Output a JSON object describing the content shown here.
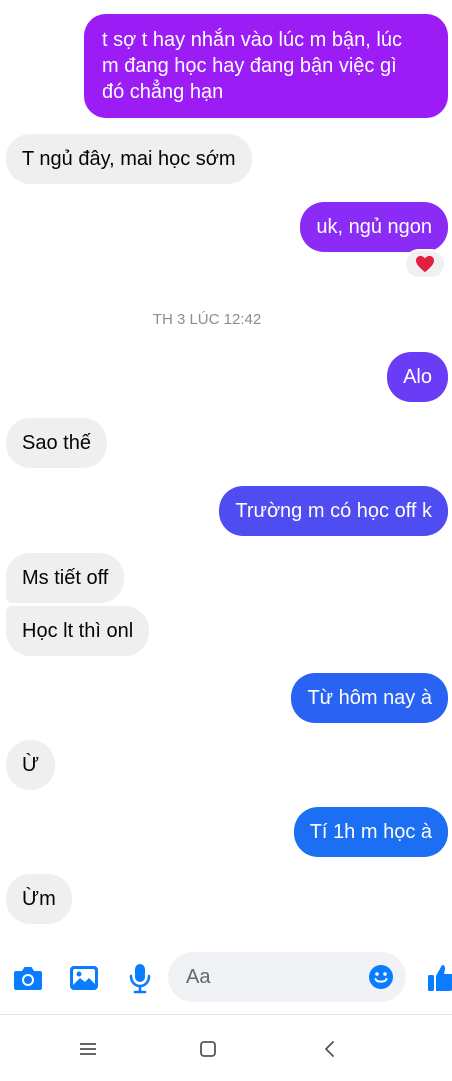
{
  "messages": [
    {
      "id": "m1",
      "direction": "out",
      "text": "t sợ t hay nhắn vào lúc m bận, lúc\nm đang học hay đang bận việc gì\nđó chẳng hạn"
    },
    {
      "id": "m2",
      "direction": "in",
      "text": "T ngủ đây, mai học sớm"
    },
    {
      "id": "m3",
      "direction": "out",
      "text": "uk, ngủ ngon"
    },
    {
      "id": "m4",
      "direction": "out",
      "text": "Alo"
    },
    {
      "id": "m5",
      "direction": "in",
      "text": "Sao thế"
    },
    {
      "id": "m6",
      "direction": "out",
      "text": "Trường m có học off k"
    },
    {
      "id": "m7",
      "direction": "in",
      "text": "Ms tiết off"
    },
    {
      "id": "m8",
      "direction": "in",
      "text": "Học lt thì onl"
    },
    {
      "id": "m9",
      "direction": "out",
      "text": "Từ hôm nay à"
    },
    {
      "id": "m10",
      "direction": "in",
      "text": "Ừ"
    },
    {
      "id": "m11",
      "direction": "out",
      "text": "Tí 1h m học à"
    },
    {
      "id": "m12",
      "direction": "in",
      "text": "Ừm"
    }
  ],
  "timestamp": "TH 3 LÚC 12:42",
  "reaction": {
    "emoji": "heart",
    "color": "#e41e3f"
  },
  "composer": {
    "placeholder": "Aa",
    "icons": [
      "camera-icon",
      "image-icon",
      "microphone-icon",
      "emoji-icon",
      "like-icon"
    ]
  },
  "colors": {
    "accent": "#0a7cff",
    "purple": "#9b1cf5",
    "violet": "#6a3cf5",
    "incoming": "#efefef"
  },
  "navbar": {
    "icons": [
      "menu-icon",
      "home-icon",
      "back-icon"
    ]
  }
}
